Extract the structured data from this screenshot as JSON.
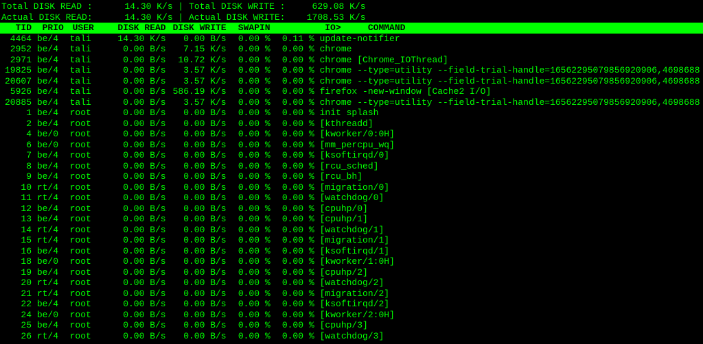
{
  "summary": {
    "line1_left_label": "Total DISK READ :",
    "line1_left_value": "14.30 K/s",
    "line1_right_label": "Total DISK WRITE :",
    "line1_right_value": "629.08 K/s",
    "line2_left_label": "Actual DISK READ:",
    "line2_left_value": "14.30 K/s",
    "line2_right_label": "Actual DISK WRITE:",
    "line2_right_value": "1708.53 K/s"
  },
  "headers": {
    "tid": "TID",
    "prio": "PRIO",
    "user": "USER",
    "disk_read": "DISK READ",
    "disk_write": "DISK WRITE",
    "swapin": "SWAPIN",
    "io": "IO>",
    "command": "COMMAND"
  },
  "rows": [
    {
      "tid": "4464",
      "prio": "be/4",
      "user": "tali",
      "dr": "14.30 K/s",
      "dw": "0.00 B/s",
      "sw": "0.00 %",
      "io": "0.11 %",
      "cmd": "update-notifier"
    },
    {
      "tid": "2952",
      "prio": "be/4",
      "user": "tali",
      "dr": "0.00 B/s",
      "dw": "7.15 K/s",
      "sw": "0.00 %",
      "io": "0.00 %",
      "cmd": "chrome"
    },
    {
      "tid": "2971",
      "prio": "be/4",
      "user": "tali",
      "dr": "0.00 B/s",
      "dw": "10.72 K/s",
      "sw": "0.00 %",
      "io": "0.00 %",
      "cmd": "chrome [Chrome_IOThread]"
    },
    {
      "tid": "19825",
      "prio": "be/4",
      "user": "tali",
      "dr": "0.00 B/s",
      "dw": "3.57 K/s",
      "sw": "0.00 %",
      "io": "0.00 %",
      "cmd": "chrome --type=utility --field-trial-handle=16562295079856920906,4698688"
    },
    {
      "tid": "20607",
      "prio": "be/4",
      "user": "tali",
      "dr": "0.00 B/s",
      "dw": "3.57 K/s",
      "sw": "0.00 %",
      "io": "0.00 %",
      "cmd": "chrome --type=utility --field-trial-handle=16562295079856920906,4698688"
    },
    {
      "tid": "5926",
      "prio": "be/4",
      "user": "tali",
      "dr": "0.00 B/s",
      "dw": "586.19 K/s",
      "sw": "0.00 %",
      "io": "0.00 %",
      "cmd": "firefox -new-window [Cache2 I/O]"
    },
    {
      "tid": "20885",
      "prio": "be/4",
      "user": "tali",
      "dr": "0.00 B/s",
      "dw": "3.57 K/s",
      "sw": "0.00 %",
      "io": "0.00 %",
      "cmd": "chrome --type=utility --field-trial-handle=16562295079856920906,4698688"
    },
    {
      "tid": "1",
      "prio": "be/4",
      "user": "root",
      "dr": "0.00 B/s",
      "dw": "0.00 B/s",
      "sw": "0.00 %",
      "io": "0.00 %",
      "cmd": "init splash"
    },
    {
      "tid": "2",
      "prio": "be/4",
      "user": "root",
      "dr": "0.00 B/s",
      "dw": "0.00 B/s",
      "sw": "0.00 %",
      "io": "0.00 %",
      "cmd": "[kthreadd]"
    },
    {
      "tid": "4",
      "prio": "be/0",
      "user": "root",
      "dr": "0.00 B/s",
      "dw": "0.00 B/s",
      "sw": "0.00 %",
      "io": "0.00 %",
      "cmd": "[kworker/0:0H]"
    },
    {
      "tid": "6",
      "prio": "be/0",
      "user": "root",
      "dr": "0.00 B/s",
      "dw": "0.00 B/s",
      "sw": "0.00 %",
      "io": "0.00 %",
      "cmd": "[mm_percpu_wq]"
    },
    {
      "tid": "7",
      "prio": "be/4",
      "user": "root",
      "dr": "0.00 B/s",
      "dw": "0.00 B/s",
      "sw": "0.00 %",
      "io": "0.00 %",
      "cmd": "[ksoftirqd/0]"
    },
    {
      "tid": "8",
      "prio": "be/4",
      "user": "root",
      "dr": "0.00 B/s",
      "dw": "0.00 B/s",
      "sw": "0.00 %",
      "io": "0.00 %",
      "cmd": "[rcu_sched]"
    },
    {
      "tid": "9",
      "prio": "be/4",
      "user": "root",
      "dr": "0.00 B/s",
      "dw": "0.00 B/s",
      "sw": "0.00 %",
      "io": "0.00 %",
      "cmd": "[rcu_bh]"
    },
    {
      "tid": "10",
      "prio": "rt/4",
      "user": "root",
      "dr": "0.00 B/s",
      "dw": "0.00 B/s",
      "sw": "0.00 %",
      "io": "0.00 %",
      "cmd": "[migration/0]"
    },
    {
      "tid": "11",
      "prio": "rt/4",
      "user": "root",
      "dr": "0.00 B/s",
      "dw": "0.00 B/s",
      "sw": "0.00 %",
      "io": "0.00 %",
      "cmd": "[watchdog/0]"
    },
    {
      "tid": "12",
      "prio": "be/4",
      "user": "root",
      "dr": "0.00 B/s",
      "dw": "0.00 B/s",
      "sw": "0.00 %",
      "io": "0.00 %",
      "cmd": "[cpuhp/0]"
    },
    {
      "tid": "13",
      "prio": "be/4",
      "user": "root",
      "dr": "0.00 B/s",
      "dw": "0.00 B/s",
      "sw": "0.00 %",
      "io": "0.00 %",
      "cmd": "[cpuhp/1]"
    },
    {
      "tid": "14",
      "prio": "rt/4",
      "user": "root",
      "dr": "0.00 B/s",
      "dw": "0.00 B/s",
      "sw": "0.00 %",
      "io": "0.00 %",
      "cmd": "[watchdog/1]"
    },
    {
      "tid": "15",
      "prio": "rt/4",
      "user": "root",
      "dr": "0.00 B/s",
      "dw": "0.00 B/s",
      "sw": "0.00 %",
      "io": "0.00 %",
      "cmd": "[migration/1]"
    },
    {
      "tid": "16",
      "prio": "be/4",
      "user": "root",
      "dr": "0.00 B/s",
      "dw": "0.00 B/s",
      "sw": "0.00 %",
      "io": "0.00 %",
      "cmd": "[ksoftirqd/1]"
    },
    {
      "tid": "18",
      "prio": "be/0",
      "user": "root",
      "dr": "0.00 B/s",
      "dw": "0.00 B/s",
      "sw": "0.00 %",
      "io": "0.00 %",
      "cmd": "[kworker/1:0H]"
    },
    {
      "tid": "19",
      "prio": "be/4",
      "user": "root",
      "dr": "0.00 B/s",
      "dw": "0.00 B/s",
      "sw": "0.00 %",
      "io": "0.00 %",
      "cmd": "[cpuhp/2]"
    },
    {
      "tid": "20",
      "prio": "rt/4",
      "user": "root",
      "dr": "0.00 B/s",
      "dw": "0.00 B/s",
      "sw": "0.00 %",
      "io": "0.00 %",
      "cmd": "[watchdog/2]"
    },
    {
      "tid": "21",
      "prio": "rt/4",
      "user": "root",
      "dr": "0.00 B/s",
      "dw": "0.00 B/s",
      "sw": "0.00 %",
      "io": "0.00 %",
      "cmd": "[migration/2]"
    },
    {
      "tid": "22",
      "prio": "be/4",
      "user": "root",
      "dr": "0.00 B/s",
      "dw": "0.00 B/s",
      "sw": "0.00 %",
      "io": "0.00 %",
      "cmd": "[ksoftirqd/2]"
    },
    {
      "tid": "24",
      "prio": "be/0",
      "user": "root",
      "dr": "0.00 B/s",
      "dw": "0.00 B/s",
      "sw": "0.00 %",
      "io": "0.00 %",
      "cmd": "[kworker/2:0H]"
    },
    {
      "tid": "25",
      "prio": "be/4",
      "user": "root",
      "dr": "0.00 B/s",
      "dw": "0.00 B/s",
      "sw": "0.00 %",
      "io": "0.00 %",
      "cmd": "[cpuhp/3]"
    },
    {
      "tid": "26",
      "prio": "rt/4",
      "user": "root",
      "dr": "0.00 B/s",
      "dw": "0.00 B/s",
      "sw": "0.00 %",
      "io": "0.00 %",
      "cmd": "[watchdog/3]"
    }
  ]
}
